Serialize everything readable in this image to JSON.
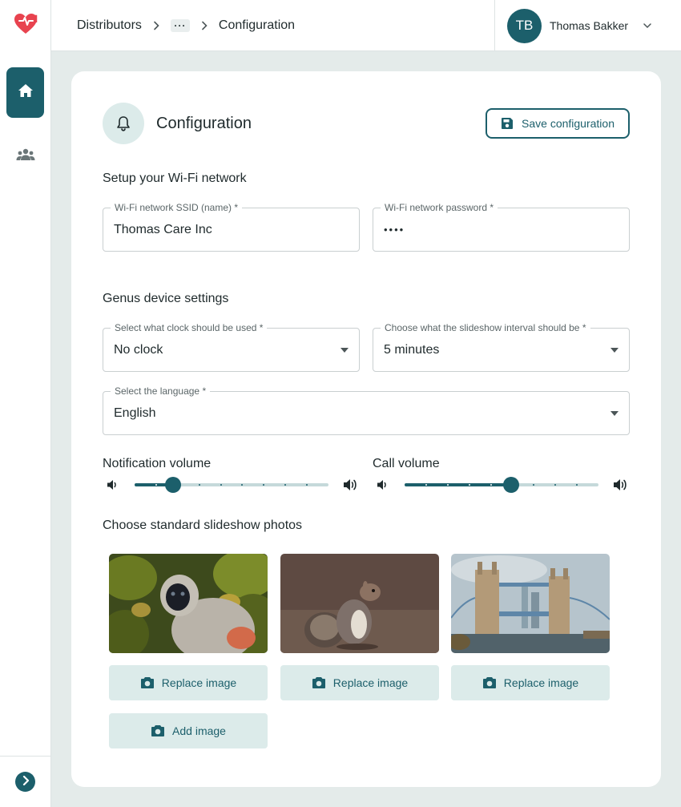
{
  "header": {
    "breadcrumb": {
      "first": "Distributors",
      "more": "···",
      "current": "Configuration"
    },
    "user": {
      "initials": "TB",
      "name": "Thomas Bakker"
    }
  },
  "sidebar": {
    "items": [
      {
        "name": "home",
        "icon": "home-icon",
        "active": true
      },
      {
        "name": "users",
        "icon": "group-icon",
        "active": false
      }
    ]
  },
  "page": {
    "title": "Configuration",
    "save_label": "Save configuration"
  },
  "wifi": {
    "section_title": "Setup your Wi-Fi network",
    "ssid_label": "Wi-Fi network SSID (name)",
    "ssid_value": "Thomas Care Inc",
    "password_label": "Wi-Fi network password",
    "password_value": "••••",
    "required_mark": "*"
  },
  "device": {
    "section_title": "Genus device settings",
    "clock_label": "Select what clock should be used",
    "clock_value": "No clock",
    "interval_label": "Choose what the slideshow interval should be",
    "interval_value": "5 minutes",
    "language_label": "Select the language",
    "language_value": "English",
    "required_mark": "*"
  },
  "volume": {
    "notification_label": "Notification volume",
    "notification_level": 0.2,
    "call_label": "Call volume",
    "call_level": 0.55,
    "steps": 9
  },
  "photos": {
    "section_title": "Choose standard slideshow photos",
    "items": [
      {
        "subject": "monkey",
        "button": "Replace image"
      },
      {
        "subject": "squirrel",
        "button": "Replace image"
      },
      {
        "subject": "tower-bridge",
        "button": "Replace image"
      }
    ],
    "add_label": "Add image"
  },
  "colors": {
    "accent": "#1c5f6b",
    "accent_light": "#dcebea",
    "background": "#e4ebea",
    "logo": "#e8434f"
  }
}
